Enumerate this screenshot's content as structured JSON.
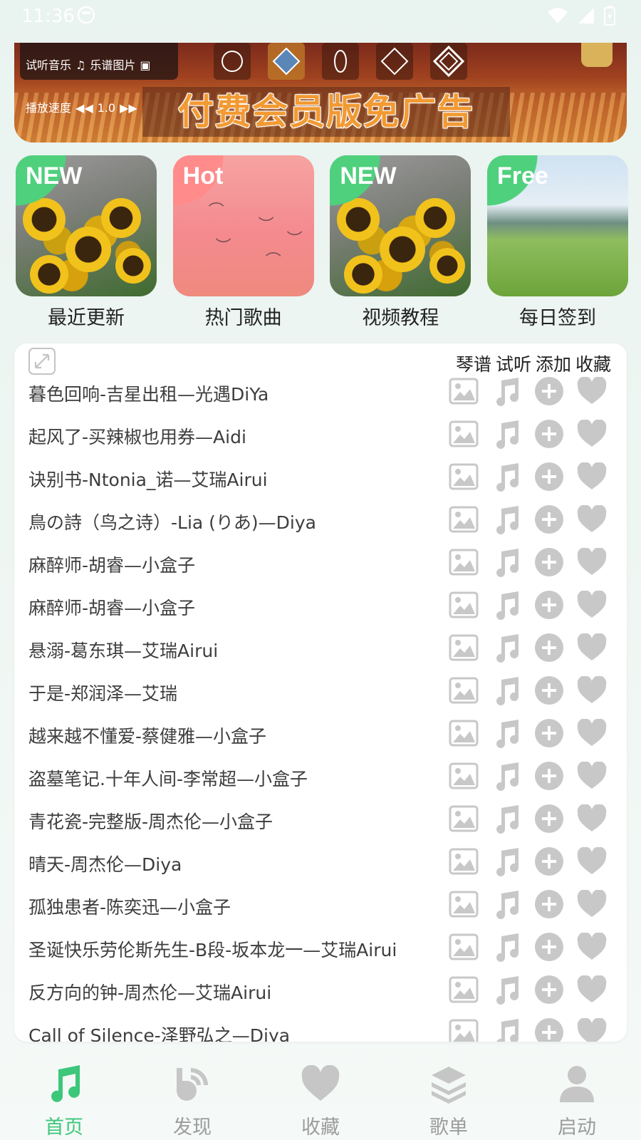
{
  "status_bar": {
    "time": "11:36"
  },
  "banner": {
    "trial_music_label": "试听音乐",
    "sheet_image_label": "乐谱图片",
    "speed_label": "播放速度",
    "speed_value": "1.0",
    "ad_text": "付费会员版免广告"
  },
  "quick_links": [
    {
      "badge": "NEW",
      "label": "最近更新"
    },
    {
      "badge": "Hot",
      "label": "热门歌曲"
    },
    {
      "badge": "NEW",
      "label": "视频教程"
    },
    {
      "badge": "Free",
      "label": "每日签到"
    }
  ],
  "list": {
    "column_headers": [
      "琴谱",
      "试听",
      "添加",
      "收藏"
    ],
    "songs": [
      "暮色回响-吉星出租—光遇DiYa",
      "起风了-买辣椒也用券—Aidi",
      "诀别书-Ntonia_诺—艾瑞Airui",
      "鳥の詩（鸟之诗）-Lia (りあ)—Diya",
      "麻醉师-胡睿—小盒子",
      "麻醉师-胡睿—小盒子",
      "悬溺-葛东琪—艾瑞Airui",
      "于是-郑润泽—艾瑞",
      "越来越不懂爱-蔡健雅—小盒子",
      "盗墓笔记.十年人间-李常超—小盒子",
      "青花瓷-完整版-周杰伦—小盒子",
      "晴天-周杰伦—Diya",
      "孤独患者-陈奕迅—小盒子",
      "圣诞快乐劳伦斯先生-B段-坂本龙一—艾瑞Airui",
      "反方向的钟-周杰伦—艾瑞Airui",
      "Call of Silence-泽野弘之—Diya"
    ]
  },
  "tabs": [
    {
      "label": "首页",
      "icon": "music-note-icon",
      "active": true
    },
    {
      "label": "发现",
      "icon": "discover-icon",
      "active": false
    },
    {
      "label": "收藏",
      "icon": "heart-icon",
      "active": false
    },
    {
      "label": "歌单",
      "icon": "layers-icon",
      "active": false
    },
    {
      "label": "启动",
      "icon": "person-icon",
      "active": false
    }
  ],
  "colors": {
    "accent": "#3cc77a",
    "icon_gray": "#c8c8c8",
    "tab_gray": "#c6c6c6"
  }
}
